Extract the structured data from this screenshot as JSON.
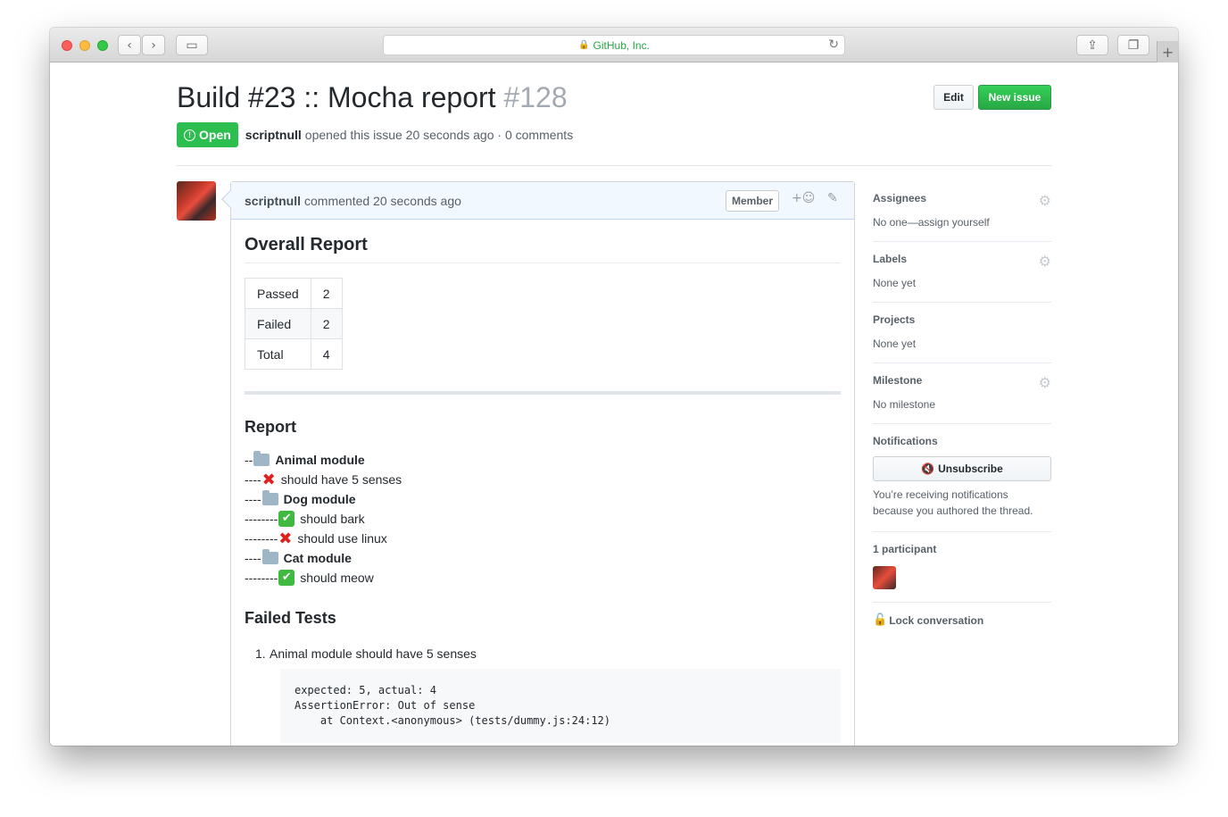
{
  "browser": {
    "url_text": "GitHub, Inc.",
    "back_icon": "chevron-left-icon",
    "forward_icon": "chevron-right-icon"
  },
  "issue": {
    "title": "Build #23 :: Mocha report",
    "number": "#128",
    "edit_label": "Edit",
    "new_issue_label": "New issue",
    "state": "Open",
    "author": "scriptnull",
    "opened_text": "opened this issue 20 seconds ago · 0 comments"
  },
  "comment": {
    "author": "scriptnull",
    "time_text": "commented 20 seconds ago",
    "badge": "Member",
    "overall_heading": "Overall Report",
    "summary": [
      {
        "label": "Passed",
        "value": "2"
      },
      {
        "label": "Failed",
        "value": "2"
      },
      {
        "label": "Total",
        "value": "4"
      }
    ],
    "report_heading": "Report",
    "tree": [
      {
        "dashes": "--",
        "icon": "folder",
        "text": "Animal module",
        "bold": true
      },
      {
        "dashes": "----",
        "icon": "cross",
        "text": "should have 5 senses",
        "bold": false
      },
      {
        "dashes": "----",
        "icon": "folder",
        "text": "Dog module",
        "bold": true
      },
      {
        "dashes": "--------",
        "icon": "check",
        "text": "should bark",
        "bold": false
      },
      {
        "dashes": "--------",
        "icon": "cross",
        "text": "should use linux",
        "bold": false
      },
      {
        "dashes": "----",
        "icon": "folder",
        "text": "Cat module",
        "bold": true
      },
      {
        "dashes": "--------",
        "icon": "check",
        "text": "should meow",
        "bold": false
      }
    ],
    "failed_heading": "Failed Tests",
    "failed_item_num": "1.",
    "failed_item": "Animal module should have 5 senses",
    "code_line1": "expected: 5, actual: 4",
    "code_line2": "AssertionError: Out of sense",
    "code_line3": "    at Context.<anonymous> (tests/dummy.js:24:12)"
  },
  "sidebar": {
    "assignees_h": "Assignees",
    "assignees_v": "No one—assign yourself",
    "labels_h": "Labels",
    "labels_v": "None yet",
    "projects_h": "Projects",
    "projects_v": "None yet",
    "milestone_h": "Milestone",
    "milestone_v": "No milestone",
    "notifications_h": "Notifications",
    "unsubscribe": "Unsubscribe",
    "notif_note": "You’re receiving notifications because you authored the thread.",
    "participants_h": "1 participant",
    "lock": "Lock conversation"
  }
}
